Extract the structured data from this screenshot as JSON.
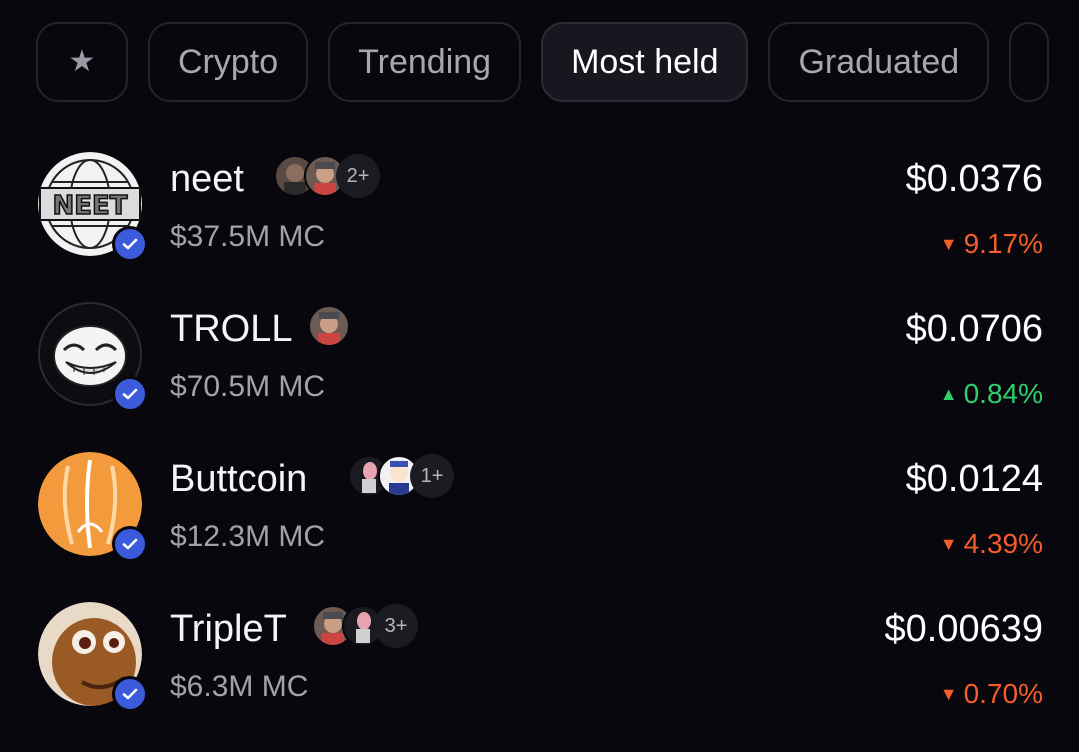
{
  "tabs": [
    {
      "label": "",
      "icon": "star-icon"
    },
    {
      "label": "Crypto"
    },
    {
      "label": "Trending"
    },
    {
      "label": "Most held",
      "active": true
    },
    {
      "label": "Graduated"
    },
    {
      "label": ""
    }
  ],
  "tokens": [
    {
      "name": "neet",
      "market_cap": "$37.5M MC",
      "price": "$0.0376",
      "change": "9.17%",
      "direction": "down",
      "holders_more": "2+",
      "verified": true
    },
    {
      "name": "TROLL",
      "market_cap": "$70.5M MC",
      "price": "$0.0706",
      "change": "0.84%",
      "direction": "up",
      "holders_more": "",
      "verified": true
    },
    {
      "name": "Buttcoin",
      "market_cap": "$12.3M MC",
      "price": "$0.0124",
      "change": "4.39%",
      "direction": "down",
      "holders_more": "1+",
      "verified": true
    },
    {
      "name": "TripleT",
      "market_cap": "$6.3M MC",
      "price": "$0.00639",
      "change": "0.70%",
      "direction": "down",
      "holders_more": "3+",
      "verified": true
    }
  ],
  "colors": {
    "background": "#07070d",
    "down": "#f25d2a",
    "up": "#2fcf6b",
    "verified": "#3b5bdb"
  }
}
